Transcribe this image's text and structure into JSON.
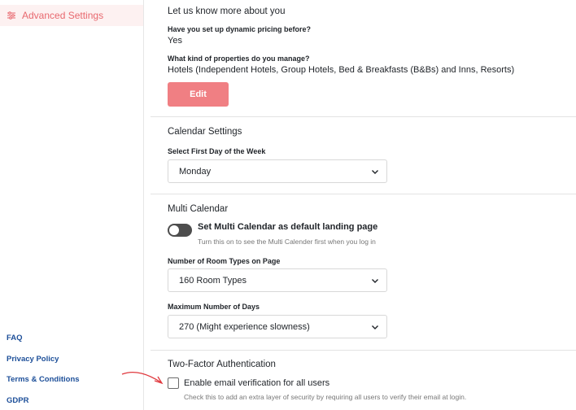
{
  "sidebar": {
    "active_item": "Advanced Settings",
    "footer_links": [
      "FAQ",
      "Privacy Policy",
      "Terms & Conditions",
      "GDPR"
    ]
  },
  "about": {
    "title": "Let us know more about you",
    "q1_label": "Have you set up dynamic pricing before?",
    "q1_value": "Yes",
    "q2_label": "What kind of properties do you manage?",
    "q2_value": "Hotels (Independent Hotels, Group Hotels, Bed & Breakfasts (B&Bs) and Inns, Resorts)",
    "edit_label": "Edit"
  },
  "calendar": {
    "title": "Calendar Settings",
    "first_day_label": "Select First Day of the Week",
    "first_day_value": "Monday"
  },
  "multi_calendar": {
    "title": "Multi Calendar",
    "toggle_label": "Set Multi Calendar as default landing page",
    "toggle_help": "Turn this on to see the Multi Calender first when you log in",
    "toggle_on": false,
    "room_types_label": "Number of Room Types on Page",
    "room_types_value": "160 Room Types",
    "max_days_label": "Maximum Number of Days",
    "max_days_value": "270 (Might experience slowness)"
  },
  "two_factor": {
    "title": "Two-Factor Authentication",
    "checkbox_label": "Enable email verification for all users",
    "checkbox_help": "Check this to add an extra layer of security by requiring all users to verify their email at login.",
    "checked": false
  },
  "colors": {
    "accent": "#f07f83",
    "sidebar_active_bg": "#fdf1f1",
    "link": "#1d4f99",
    "annotation_arrow": "#e0393e"
  },
  "icons": {
    "sidebar_active": "sliders-icon",
    "select": "chevron-down-icon"
  }
}
